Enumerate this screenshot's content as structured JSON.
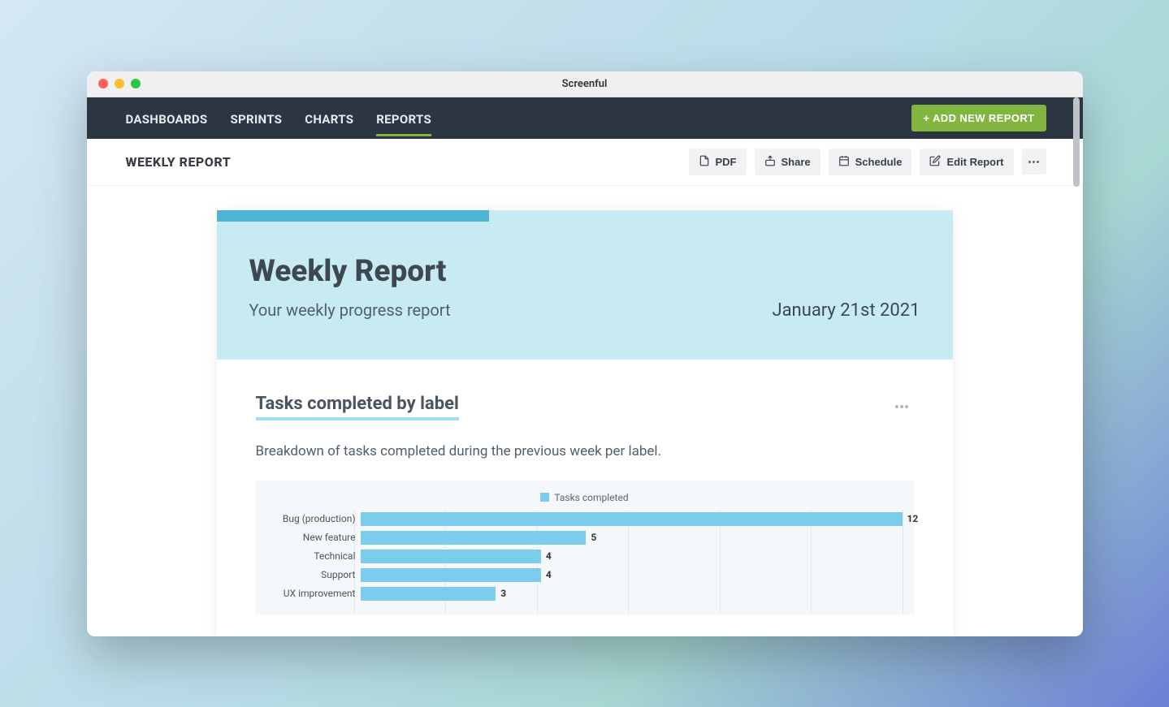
{
  "window": {
    "title": "Screenful"
  },
  "nav": {
    "items": [
      "DASHBOARDS",
      "SPRINTS",
      "CHARTS",
      "REPORTS"
    ],
    "active_index": 3,
    "add_button": "+ ADD NEW REPORT"
  },
  "subheader": {
    "title": "WEEKLY REPORT",
    "actions": {
      "pdf": "PDF",
      "share": "Share",
      "schedule": "Schedule",
      "edit": "Edit Report"
    }
  },
  "report": {
    "title": "Weekly Report",
    "subtitle": "Your weekly progress report",
    "date": "January 21st 2021",
    "section": {
      "title": "Tasks completed by label",
      "description": "Breakdown of tasks completed during the previous week per label."
    }
  },
  "chart_data": {
    "type": "bar",
    "orientation": "horizontal",
    "title": "Tasks completed by label",
    "legend": "Tasks completed",
    "xlabel": "",
    "ylabel": "",
    "xlim": [
      0,
      12
    ],
    "gridlines": [
      0,
      2,
      4,
      6,
      8,
      10,
      12
    ],
    "categories": [
      "Bug (production)",
      "New feature",
      "Technical",
      "Support",
      "UX improvement"
    ],
    "values": [
      12,
      5,
      4,
      4,
      3
    ],
    "series": [
      {
        "name": "Tasks completed",
        "values": [
          12,
          5,
          4,
          4,
          3
        ],
        "color": "#7ccdec"
      }
    ]
  }
}
